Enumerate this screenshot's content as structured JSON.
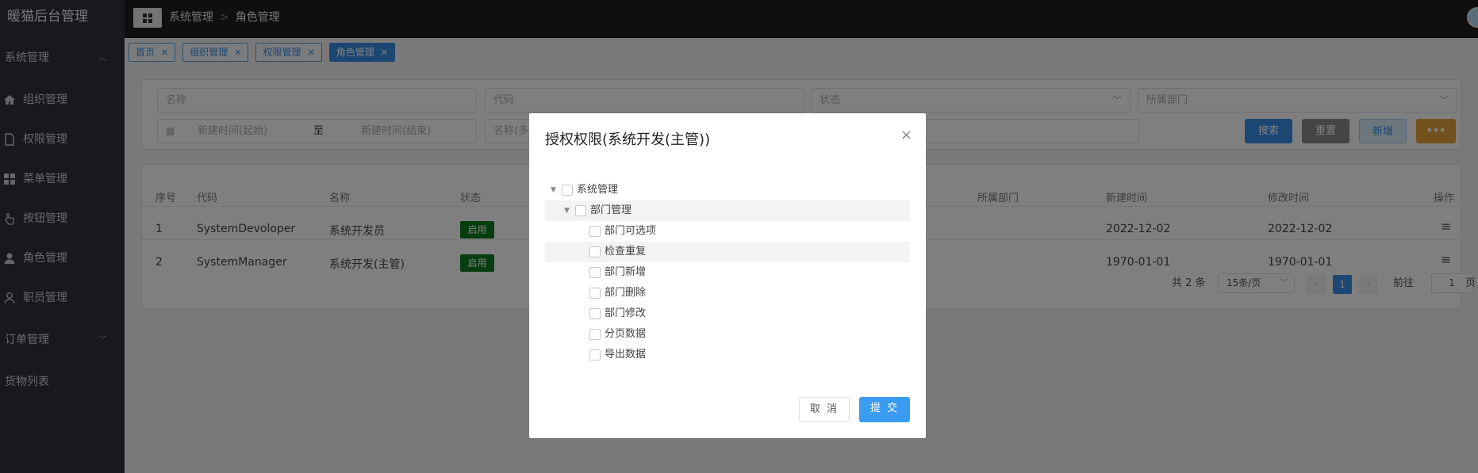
{
  "app": {
    "title": "暖猫后台管理"
  },
  "sidebar": {
    "groups": [
      {
        "label": "系统管理",
        "expanded": true
      },
      {
        "label": "订单管理",
        "expanded": false
      }
    ],
    "items": [
      {
        "label": "组织管理",
        "icon": "home-icon"
      },
      {
        "label": "权限管理",
        "icon": "doc-icon"
      },
      {
        "label": "菜单管理",
        "icon": "grid-icon"
      },
      {
        "label": "按钮管理",
        "icon": "hand-icon"
      },
      {
        "label": "角色管理",
        "icon": "user-filled-icon"
      },
      {
        "label": "职员管理",
        "icon": "user-icon"
      }
    ],
    "extra_item": "货物列表"
  },
  "header": {
    "breadcrumb": [
      "系统管理",
      "角色管理"
    ],
    "breadcrumb_sep": ">"
  },
  "tabs": [
    {
      "label": "首页",
      "active": false
    },
    {
      "label": "组织管理",
      "active": false
    },
    {
      "label": "权限管理",
      "active": false
    },
    {
      "label": "角色管理",
      "active": true
    }
  ],
  "search": {
    "name_placeholder": "名称",
    "code_placeholder": "代码",
    "status_placeholder": "状态",
    "dept_placeholder": "所属部门",
    "start_placeholder": "新建时间(起始)",
    "range_sep": "至",
    "end_placeholder": "新建时间(结束)",
    "multi_placeholder": "名称(多",
    "buttons": {
      "search": "搜索",
      "reset": "重置",
      "add": "新增",
      "more": "•••"
    }
  },
  "table": {
    "headers": [
      "序号",
      "代码",
      "名称",
      "状态",
      "所属部门",
      "新建时间",
      "修改时间",
      "操作"
    ],
    "rows": [
      {
        "index": "1",
        "code": "SystemDevoloper",
        "name": "系统开发员",
        "status": "启用",
        "created": "2022-12-02",
        "modified": "2022-12-02",
        "ops": "≡"
      },
      {
        "index": "2",
        "code": "SystemManager",
        "name": "系统开发(主管)",
        "status": "启用",
        "created": "1970-01-01",
        "modified": "1970-01-01",
        "ops": "≡"
      }
    ]
  },
  "pagination": {
    "total": "共 2 条",
    "page_size": "15条/页",
    "current_page": "1",
    "prev": "‹",
    "next": "›",
    "goto_label": "前往",
    "goto_value": "1",
    "goto_suffix": "页"
  },
  "modal": {
    "title": "授权权限(系统开发(主管))",
    "close": "×",
    "tree": [
      {
        "label": "系统管理",
        "level": 0,
        "has_caret": true,
        "highlight": false
      },
      {
        "label": "部门管理",
        "level": 1,
        "has_caret": true,
        "highlight": true
      },
      {
        "label": "部门可选项",
        "level": 2,
        "has_caret": false,
        "highlight": false
      },
      {
        "label": "检查重复",
        "level": 2,
        "has_caret": false,
        "highlight": true
      },
      {
        "label": "部门新增",
        "level": 2,
        "has_caret": false,
        "highlight": false
      },
      {
        "label": "部门删除",
        "level": 2,
        "has_caret": false,
        "highlight": false
      },
      {
        "label": "部门修改",
        "level": 2,
        "has_caret": false,
        "highlight": false
      },
      {
        "label": "分页数据",
        "level": 2,
        "has_caret": false,
        "highlight": false
      },
      {
        "label": "导出数据",
        "level": 2,
        "has_caret": false,
        "highlight": false
      }
    ],
    "cancel": "取 消",
    "submit": "提 交"
  },
  "colors": {
    "primary": "#3a8ee6",
    "success": "#0a7a1f",
    "warning": "#e6a23c",
    "sidebar": "#2f323a",
    "topbar": "#1f1f1f"
  }
}
